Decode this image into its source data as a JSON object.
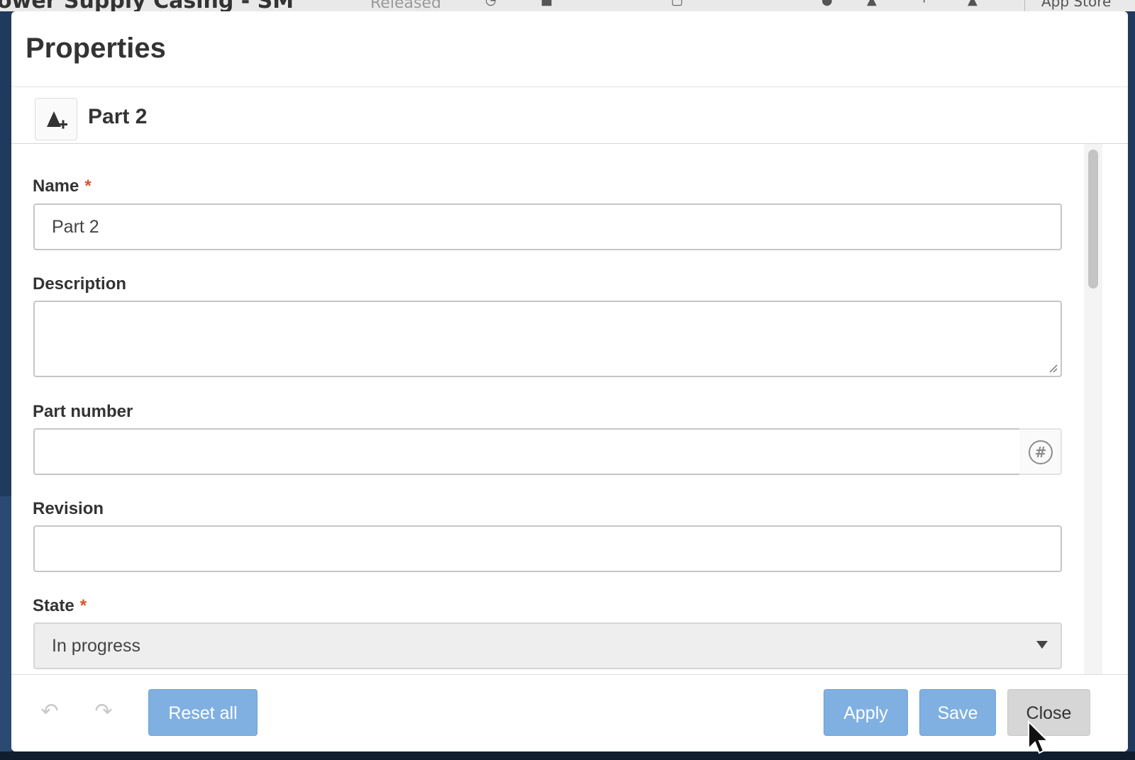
{
  "background": {
    "doc_title": "ower Supply Casing - SM",
    "doc_status": "Released",
    "app_store_label": "App Store"
  },
  "dialog": {
    "title": "Properties",
    "part_name": "Part 2",
    "part_icon": "part-add-icon"
  },
  "fields": {
    "name": {
      "label": "Name",
      "required": "*",
      "value": "Part 2"
    },
    "description": {
      "label": "Description",
      "value": ""
    },
    "part_number": {
      "label": "Part number",
      "value": "",
      "button_icon": "hash-generate-icon"
    },
    "revision": {
      "label": "Revision",
      "value": ""
    },
    "state": {
      "label": "State",
      "required": "*",
      "value": "In progress"
    }
  },
  "footer": {
    "undo_icon": "undo-icon",
    "redo_icon": "redo-icon",
    "reset_all": "Reset all",
    "apply": "Apply",
    "save": "Save",
    "close": "Close"
  },
  "colors": {
    "primary_button": "#7fb0e1",
    "required_asterisk": "#d9532b",
    "close_button": "#d6d6d6"
  }
}
